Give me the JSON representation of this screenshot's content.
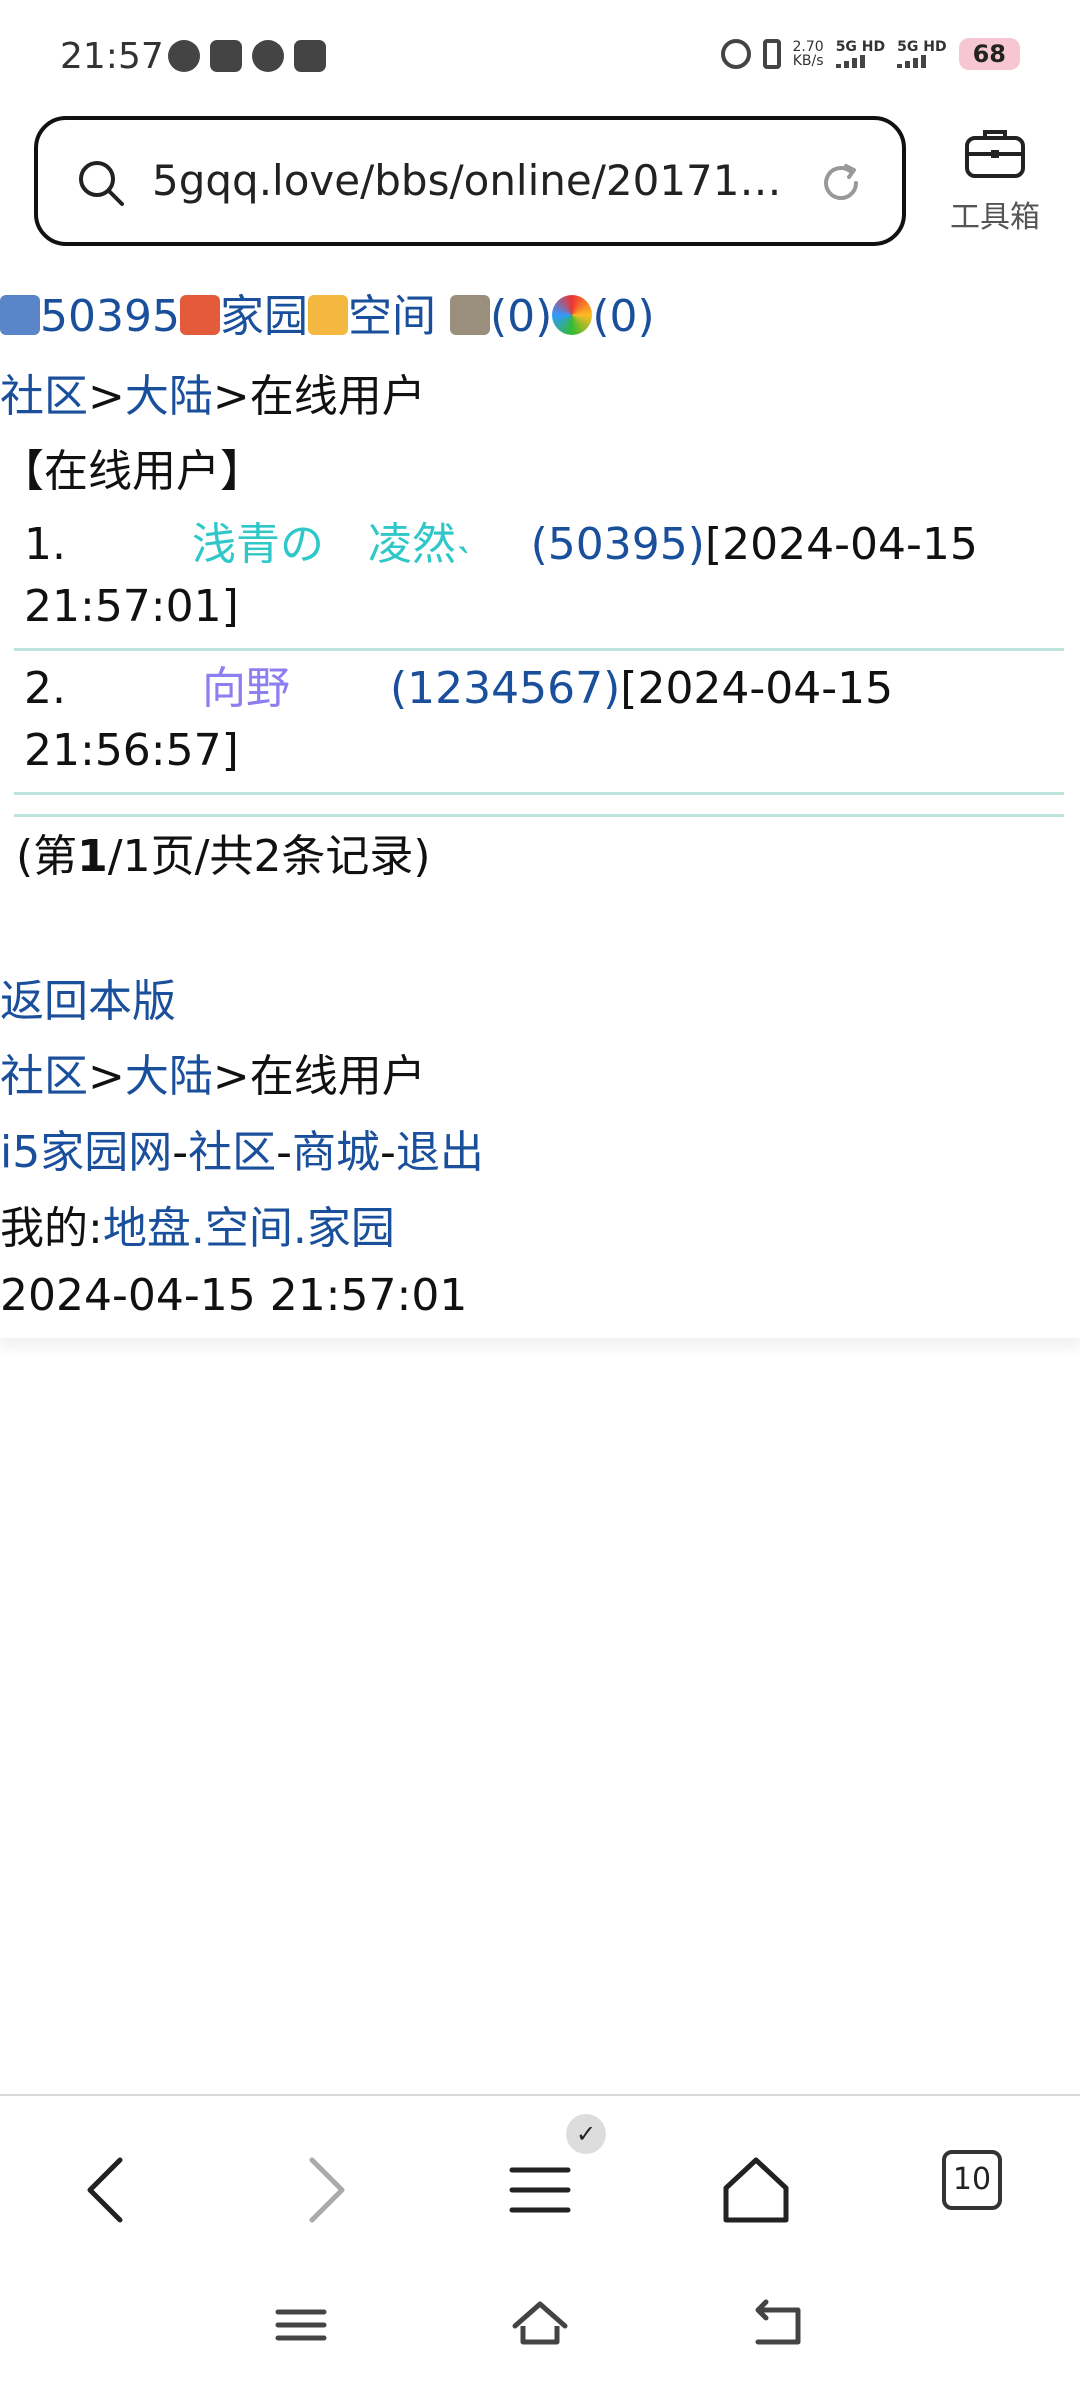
{
  "status_bar": {
    "time": "21:57",
    "net_speed_value": "2.70",
    "net_speed_unit": "KB/s",
    "sim1": "5G HD",
    "sim2": "5G HD",
    "battery": "68"
  },
  "browser": {
    "url": "5gqq.love/bbs/online/20171…",
    "toolbox_label": "工具箱",
    "tab_count": "10"
  },
  "header_links": {
    "user_id": "50395",
    "home": "家园",
    "space": "空间",
    "count1": "(0)",
    "count2": "(0)"
  },
  "breadcrumb": {
    "community": "社区",
    "sep": ">",
    "mainland": "大陆",
    "current": "在线用户"
  },
  "section_title": "【在线用户】",
  "online_users": [
    {
      "index": "1.",
      "name": "浅青の　凌然˴",
      "id": "(50395)",
      "time_part1": "[2024-04-15",
      "time_part2": "21:57:01]"
    },
    {
      "index": "2.",
      "name": "向野",
      "id": "(1234567)",
      "time_part1": "[2024-04-15",
      "time_part2": "21:56:57]"
    }
  ],
  "pagination": {
    "prefix": "(第",
    "page": "1",
    "suffix": "/1页/共2条记录)"
  },
  "footer": {
    "back_link": "返回本版",
    "site_link": "i5家园网",
    "community_link": "社区",
    "mall_link": "商城",
    "logout_link": "退出",
    "dash": "-",
    "mine_label": "我的:",
    "land_link": "地盘",
    "space_link": "空间",
    "home_link": "家园",
    "dot": ".",
    "timestamp": "2024-04-15 21:57:01"
  }
}
